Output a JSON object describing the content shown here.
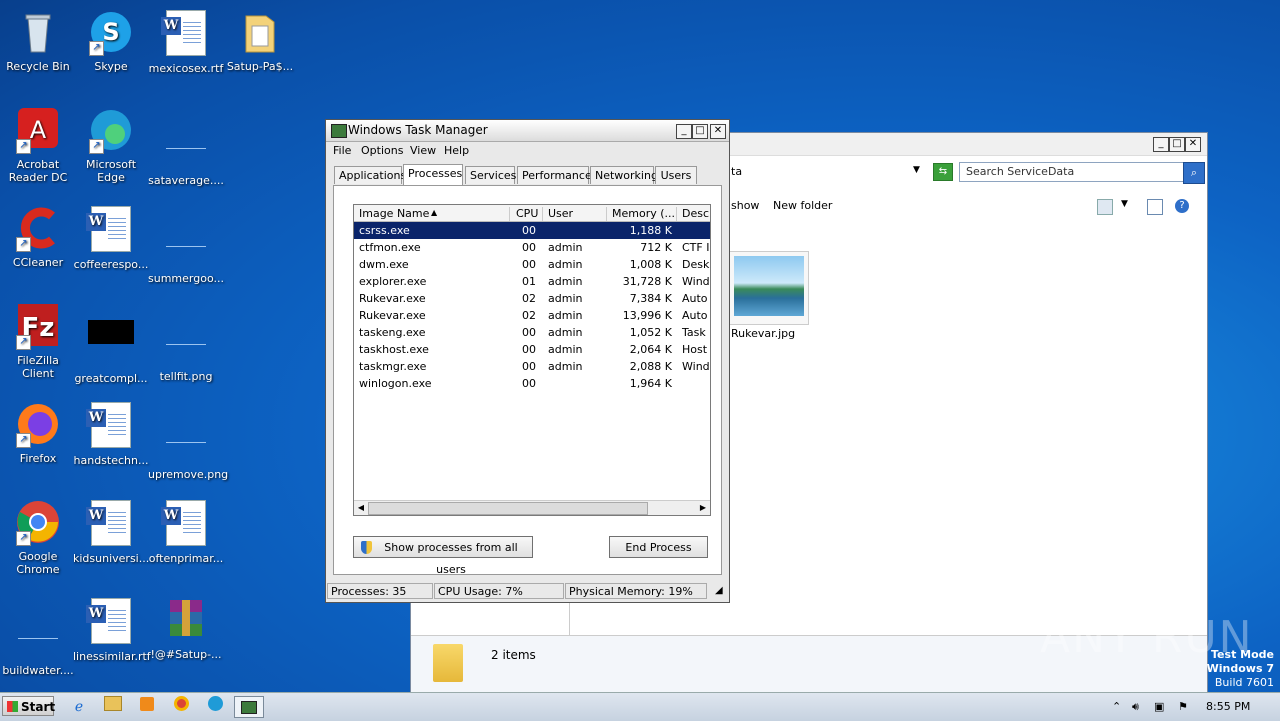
{
  "desktop": {
    "icons": [
      {
        "label": "Recycle Bin",
        "icon": "recycle-bin-icon"
      },
      {
        "label": "Skype",
        "icon": "skype-icon"
      },
      {
        "label": "mexicosex.rtf",
        "icon": "word-doc-icon"
      },
      {
        "label": "Satup-Pa$...",
        "icon": "folder-icon"
      },
      {
        "label": "Acrobat Reader DC",
        "icon": "acrobat-icon"
      },
      {
        "label": "Microsoft Edge",
        "icon": "edge-icon"
      },
      {
        "label": "sataverage....",
        "icon": "blank-file-icon"
      },
      {
        "label": "CCleaner",
        "icon": "ccleaner-icon"
      },
      {
        "label": "coffeerespo...",
        "icon": "word-doc-icon"
      },
      {
        "label": "summergoo...",
        "icon": "blank-file-icon"
      },
      {
        "label": "FileZilla Client",
        "icon": "filezilla-icon"
      },
      {
        "label": "greatcompl...",
        "icon": "black-file-icon"
      },
      {
        "label": "tellfit.png",
        "icon": "blank-file-icon"
      },
      {
        "label": "Firefox",
        "icon": "firefox-icon"
      },
      {
        "label": "handstechn...",
        "icon": "word-doc-icon"
      },
      {
        "label": "upremove.png",
        "icon": "blank-file-icon"
      },
      {
        "label": "Google Chrome",
        "icon": "chrome-icon"
      },
      {
        "label": "kidsuniversi...",
        "icon": "word-doc-icon"
      },
      {
        "label": "oftenprimar...",
        "icon": "word-doc-icon"
      },
      {
        "label": "buildwater....",
        "icon": "blank-file-icon"
      },
      {
        "label": "linessimilar.rtf",
        "icon": "word-doc-icon"
      },
      {
        "label": "!@#Satup-...",
        "icon": "winrar-icon"
      }
    ]
  },
  "explorer": {
    "address_fragment": "ta",
    "search_placeholder": "Search ServiceData",
    "toolbar": {
      "slideshow": "show",
      "new_folder": "New folder"
    },
    "file": {
      "name": "Rukevar.jpg"
    },
    "status": {
      "items": "2 items"
    }
  },
  "taskmgr": {
    "title": "Windows Task Manager",
    "menu": [
      "File",
      "Options",
      "View",
      "Help"
    ],
    "tabs": [
      "Applications",
      "Processes",
      "Services",
      "Performance",
      "Networking",
      "Users"
    ],
    "active_tab": "Processes",
    "columns": [
      "Image Name",
      "CPU",
      "User Name",
      "Memory (...",
      "Desc"
    ],
    "rows": [
      {
        "name": "csrss.exe",
        "cpu": "00",
        "user": "",
        "mem": "1,188 K",
        "desc": ""
      },
      {
        "name": "ctfmon.exe",
        "cpu": "00",
        "user": "admin",
        "mem": "712 K",
        "desc": "CTF I"
      },
      {
        "name": "dwm.exe",
        "cpu": "00",
        "user": "admin",
        "mem": "1,008 K",
        "desc": "Desk"
      },
      {
        "name": "explorer.exe",
        "cpu": "01",
        "user": "admin",
        "mem": "31,728 K",
        "desc": "Wind"
      },
      {
        "name": "Rukevar.exe",
        "cpu": "02",
        "user": "admin",
        "mem": "7,384 K",
        "desc": "Auto"
      },
      {
        "name": "Rukevar.exe",
        "cpu": "02",
        "user": "admin",
        "mem": "13,996 K",
        "desc": "Auto"
      },
      {
        "name": "taskeng.exe",
        "cpu": "00",
        "user": "admin",
        "mem": "1,052 K",
        "desc": "Task"
      },
      {
        "name": "taskhost.exe",
        "cpu": "00",
        "user": "admin",
        "mem": "2,064 K",
        "desc": "Host"
      },
      {
        "name": "taskmgr.exe",
        "cpu": "00",
        "user": "admin",
        "mem": "2,088 K",
        "desc": "Wind"
      },
      {
        "name": "winlogon.exe",
        "cpu": "00",
        "user": "",
        "mem": "1,964 K",
        "desc": ""
      }
    ],
    "buttons": {
      "show_all": "Show processes from all users",
      "end_process": "End Process"
    },
    "status": {
      "processes": "Processes: 35",
      "cpu": "CPU Usage: 7%",
      "memory": "Physical Memory: 19%"
    }
  },
  "taskbar": {
    "start": "Start",
    "clock": "8:55 PM"
  },
  "watermark": "ANY RUN",
  "test_mode": {
    "line1": "Test Mode",
    "line2": "Windows 7",
    "line3": "Build 7601"
  }
}
